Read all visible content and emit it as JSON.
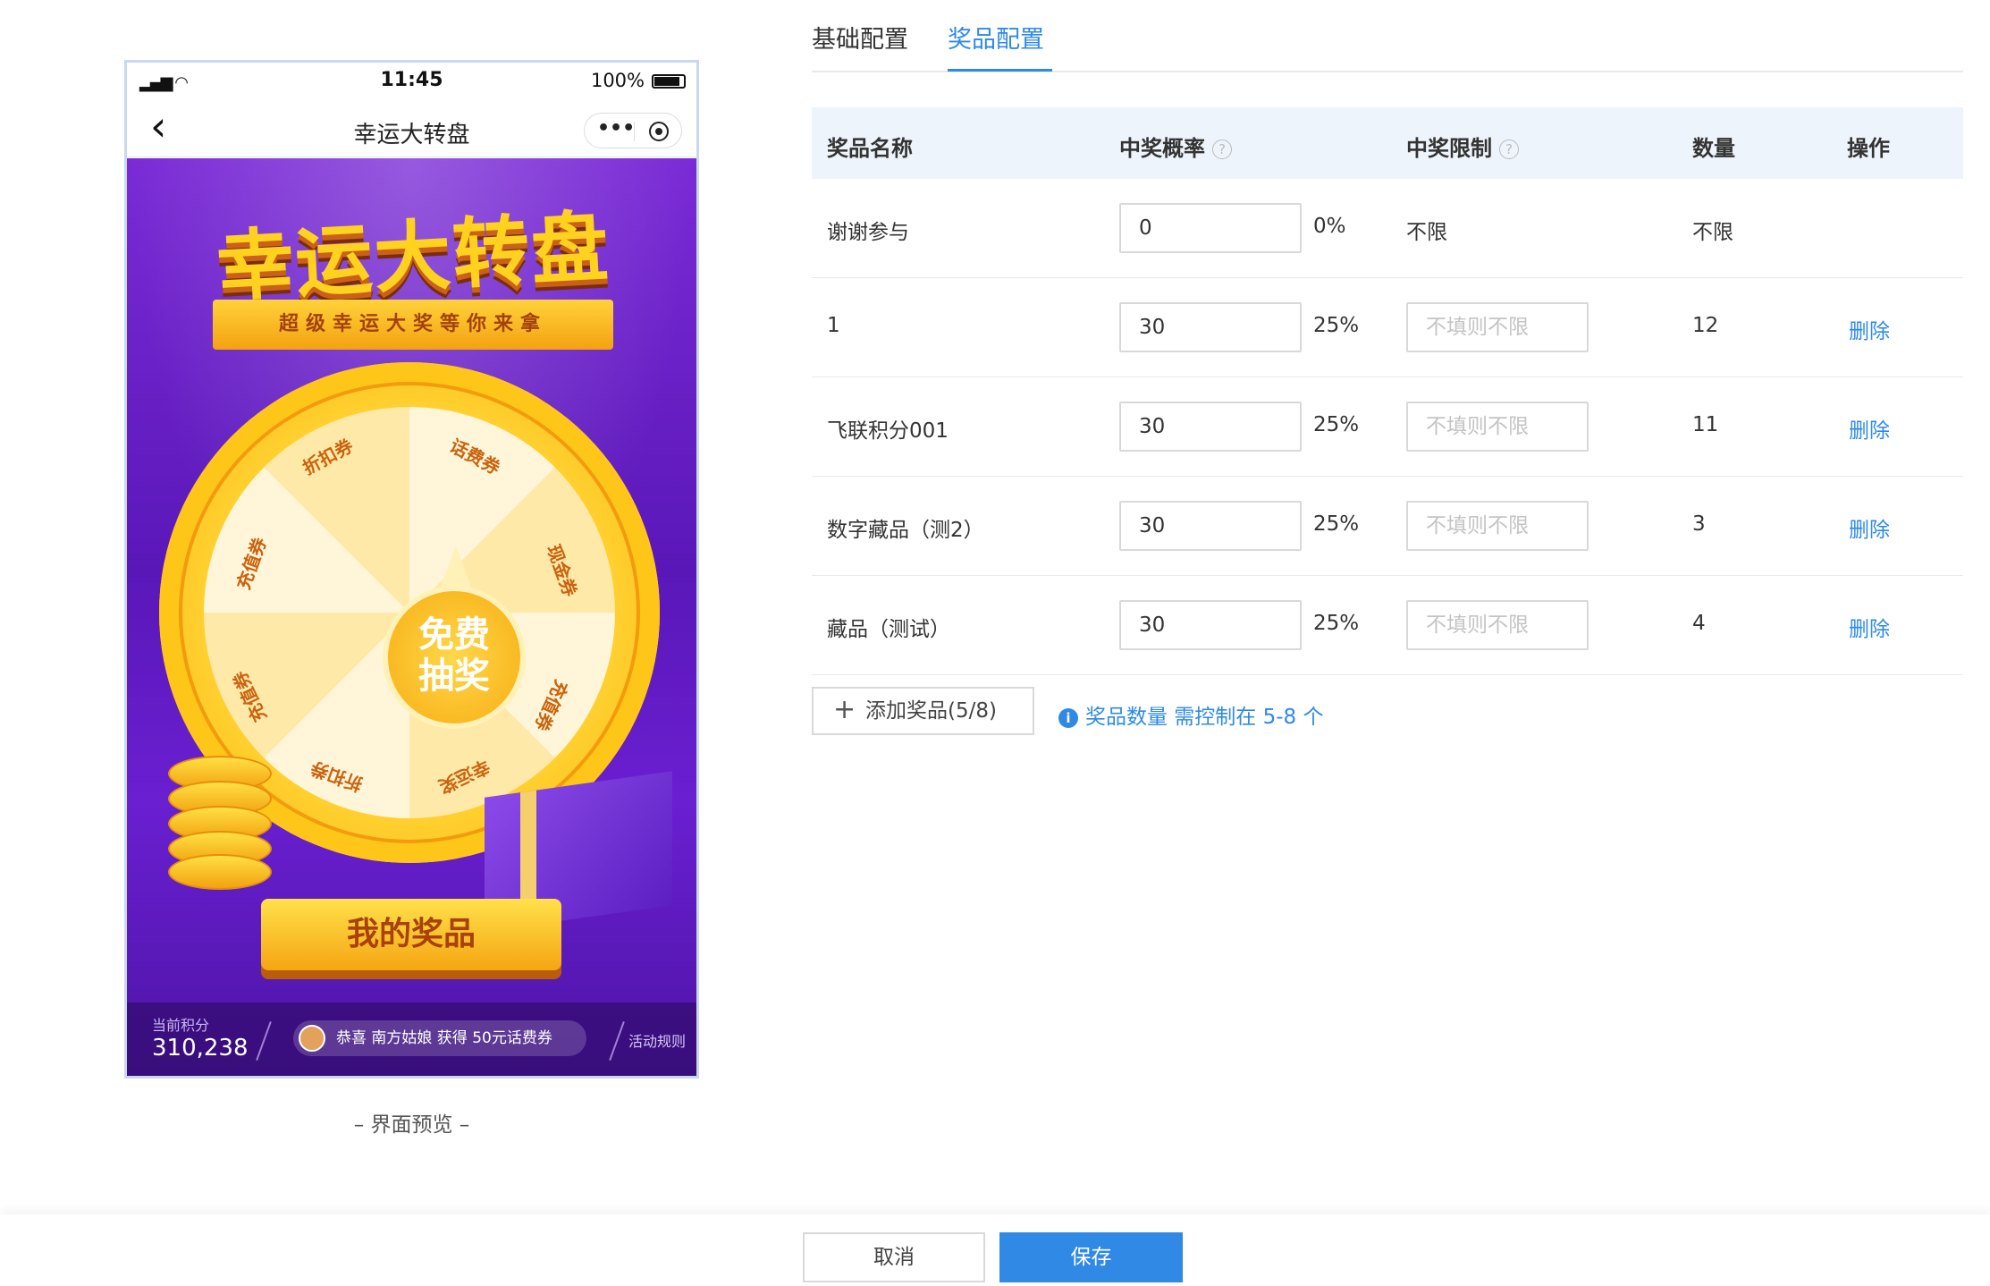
{
  "preview": {
    "status_time": "11:45",
    "status_battery": "100%",
    "nav_title": "幸运大转盘",
    "capsule_more": "•••",
    "game": {
      "title": "幸运大转盘",
      "subtitle": "超级幸运大奖等你来拿",
      "wheel_labels": [
        "折扣券",
        "话费券",
        "现金券",
        "充值券",
        "幸运奖",
        "折扣券",
        "充值券",
        "充值券"
      ],
      "center_line1": "免费",
      "center_line2": "抽奖",
      "my_prizes_button": "我的奖品",
      "points_label": "当前积分",
      "points_value": "310,238",
      "notice": "恭喜 南方姑娘 获得 50元话费券",
      "rules_link": "活动规则"
    },
    "caption": "– 界面预览 –"
  },
  "tabs": [
    {
      "label": "基础配置"
    },
    {
      "label": "奖品配置"
    }
  ],
  "active_tab": "奖品配置",
  "table": {
    "headers": {
      "name": "奖品名称",
      "probability": "中奖概率",
      "limit": "中奖限制",
      "quantity": "数量",
      "action": "操作"
    },
    "limit_placeholder": "不填则不限",
    "rows": [
      {
        "name": "谢谢参与",
        "weight": "0",
        "percent": "0%",
        "limit": "不限",
        "quantity": "不限",
        "action": ""
      },
      {
        "name": "1",
        "weight": "30",
        "percent": "25%",
        "limit": "",
        "quantity": "12",
        "action": "删除"
      },
      {
        "name": "飞联积分001",
        "weight": "30",
        "percent": "25%",
        "limit": "",
        "quantity": "11",
        "action": "删除"
      },
      {
        "name": "数字藏品（测2）",
        "weight": "30",
        "percent": "25%",
        "limit": "",
        "quantity": "3",
        "action": "删除"
      },
      {
        "name": "藏品（测试）",
        "weight": "30",
        "percent": "25%",
        "limit": "",
        "quantity": "4",
        "action": "删除"
      }
    ]
  },
  "add_button": "添加奖品(5/8)",
  "hint": "奖品数量 需控制在 5-8 个",
  "footer": {
    "cancel": "取消",
    "save": "保存"
  },
  "colors": {
    "accent": "#2f89e5",
    "header_bg": "#eef4fb",
    "game_purple": "#5a17b8",
    "gold": "#ffd21f"
  }
}
